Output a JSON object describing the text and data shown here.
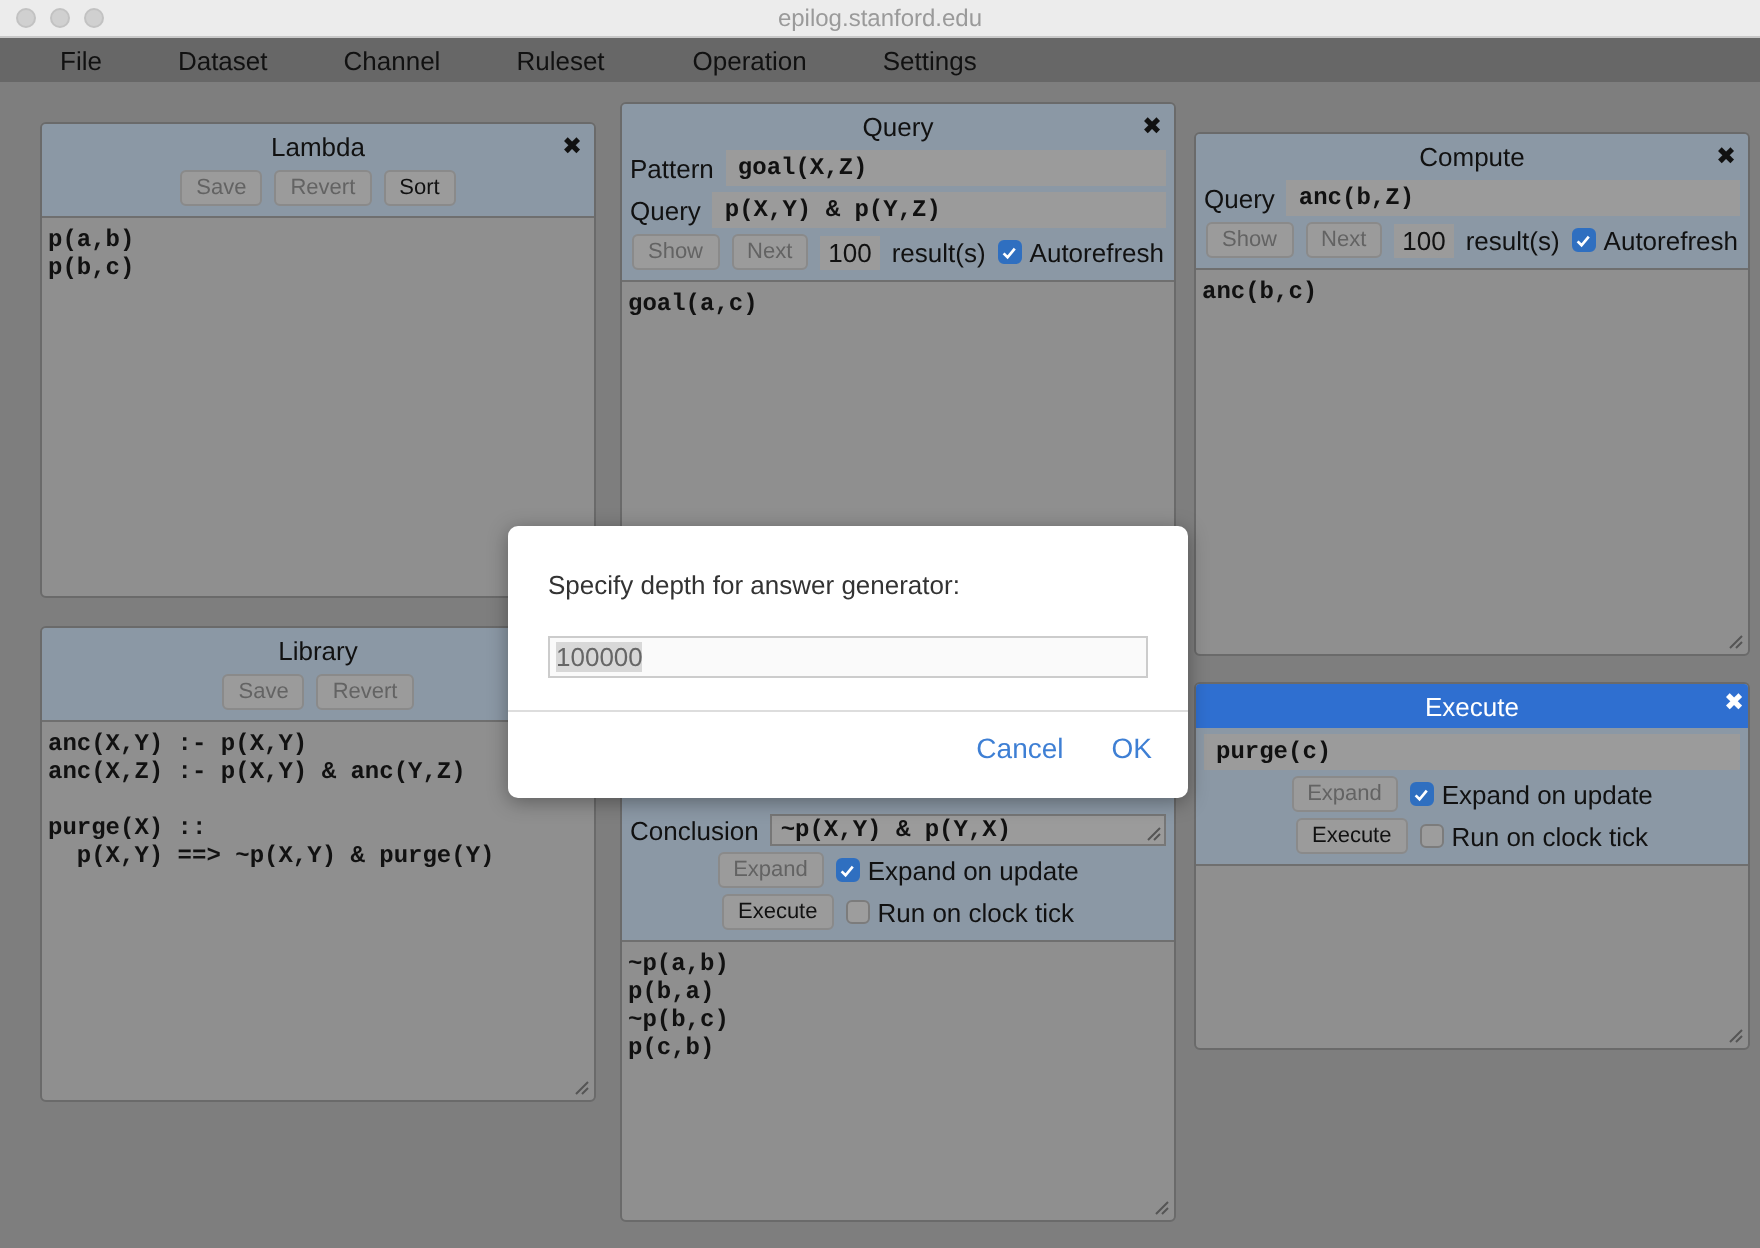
{
  "window": {
    "title": "epilog.stanford.edu"
  },
  "menu": [
    "File",
    "Dataset",
    "Channel",
    "Ruleset",
    "Operation",
    "Settings"
  ],
  "panels": [
    {
      "title": "Lambda",
      "active": false,
      "close": "✖",
      "rows": [
        [
          {
            "kind": "button",
            "label": "Save",
            "disabled": true
          },
          {
            "kind": "button",
            "label": "Revert",
            "disabled": true
          },
          {
            "kind": "button",
            "label": "Sort",
            "disabled": false
          }
        ]
      ],
      "output": "p(a,b)\np(b,c)"
    },
    {
      "title": "Library",
      "active": false,
      "rows": [
        [
          {
            "kind": "button",
            "label": "Save",
            "disabled": true
          },
          {
            "kind": "button",
            "label": "Revert",
            "disabled": true
          }
        ]
      ],
      "output": "anc(X,Y) :- p(X,Y)\nanc(X,Z) :- p(X,Y) & anc(Y,Z)\n\npurge(X) ::\n  p(X,Y) ==> ~p(X,Y) & purge(Y)"
    },
    {
      "title": "Query",
      "active": false,
      "close": "✖",
      "fields": [
        {
          "label": "Pattern",
          "value": "goal(X,Z)"
        },
        {
          "label": "Query",
          "value": "p(X,Y) & p(Y,Z)"
        }
      ],
      "rows": [
        [
          {
            "kind": "button",
            "label": "Show",
            "disabled": true
          },
          {
            "kind": "button",
            "label": "Next",
            "disabled": true
          },
          {
            "kind": "count",
            "value": "100"
          },
          {
            "kind": "text",
            "label": "result(s)"
          },
          {
            "kind": "checkbox",
            "label": "Autorefresh",
            "checked": true
          }
        ]
      ],
      "output": "goal(a,c)"
    },
    {
      "active": false,
      "fields": [
        {
          "label": "Conclusion",
          "value": "~p(X,Y) & p(Y,X)",
          "multiline": true
        }
      ],
      "rows": [
        [
          {
            "kind": "button",
            "label": "Expand",
            "disabled": true
          },
          {
            "kind": "checkbox",
            "label": "Expand on update",
            "checked": true
          }
        ],
        [
          {
            "kind": "button",
            "label": "Execute",
            "disabled": false
          },
          {
            "kind": "checkbox",
            "label": "Run on clock tick",
            "checked": false
          }
        ]
      ],
      "output": "~p(a,b)\np(b,a)\n~p(b,c)\np(c,b)"
    },
    {
      "title": "Compute",
      "active": false,
      "close": "✖",
      "fields": [
        {
          "label": "Query",
          "value": "anc(b,Z)"
        }
      ],
      "rows": [
        [
          {
            "kind": "button",
            "label": "Show",
            "disabled": true
          },
          {
            "kind": "button",
            "label": "Next",
            "disabled": true
          },
          {
            "kind": "count",
            "value": "100"
          },
          {
            "kind": "text",
            "label": "result(s)"
          },
          {
            "kind": "checkbox",
            "label": "Autorefresh",
            "checked": true
          }
        ]
      ],
      "output": "anc(b,c)"
    },
    {
      "title": "Execute",
      "active": true,
      "close": "✖",
      "fields": [
        {
          "value": "purge(c)"
        }
      ],
      "rows": [
        [
          {
            "kind": "button",
            "label": "Expand",
            "disabled": true
          },
          {
            "kind": "checkbox",
            "label": "Expand on update",
            "checked": true
          }
        ],
        [
          {
            "kind": "button",
            "label": "Execute",
            "disabled": false
          },
          {
            "kind": "checkbox",
            "label": "Run on clock tick",
            "checked": false
          }
        ]
      ]
    }
  ],
  "dialog": {
    "message": "Specify depth for answer generator:",
    "value": "100000",
    "buttons": [
      "Cancel",
      "OK"
    ]
  }
}
